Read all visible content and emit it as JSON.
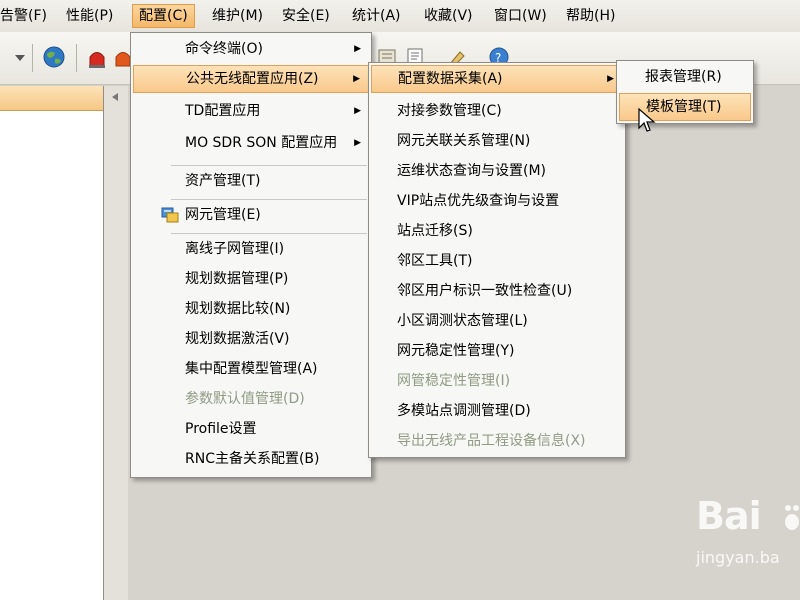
{
  "menubar": [
    {
      "label": "告警(F)"
    },
    {
      "label": "性能(P)"
    },
    {
      "label": "配置(C)"
    },
    {
      "label": "维护(M)"
    },
    {
      "label": "安全(E)"
    },
    {
      "label": "统计(A)"
    },
    {
      "label": "收藏(V)"
    },
    {
      "label": "窗口(W)"
    },
    {
      "label": "帮助(H)"
    }
  ],
  "config_menu": {
    "items": [
      {
        "label": "命令终端(O)"
      },
      {
        "label": "公共无线配置应用(Z)"
      },
      {
        "label": "TD配置应用"
      },
      {
        "label": "MO SDR SON 配置应用"
      },
      {
        "label": "资产管理(T)"
      },
      {
        "label": "网元管理(E)"
      },
      {
        "label": "离线子网管理(I)"
      },
      {
        "label": "规划数据管理(P)"
      },
      {
        "label": "规划数据比较(N)"
      },
      {
        "label": "规划数据激活(V)"
      },
      {
        "label": "集中配置模型管理(A)"
      },
      {
        "label": "参数默认值管理(D)"
      },
      {
        "label": "Profile设置"
      },
      {
        "label": "RNC主备关系配置(B)"
      }
    ]
  },
  "public_wireless_menu": {
    "items": [
      {
        "label": "配置数据采集(A)"
      },
      {
        "label": "对接参数管理(C)"
      },
      {
        "label": "网元关联关系管理(N)"
      },
      {
        "label": "运维状态查询与设置(M)"
      },
      {
        "label": "VIP站点优先级查询与设置"
      },
      {
        "label": "站点迁移(S)"
      },
      {
        "label": "邻区工具(T)"
      },
      {
        "label": "邻区用户标识一致性检查(U)"
      },
      {
        "label": "小区调测状态管理(L)"
      },
      {
        "label": "网元稳定性管理(Y)"
      },
      {
        "label": "网管稳定性管理(I)"
      },
      {
        "label": "多模站点调测管理(D)"
      },
      {
        "label": "导出无线产品工程设备信息(X)"
      }
    ]
  },
  "collect_menu": {
    "items": [
      {
        "label": "报表管理(R)"
      },
      {
        "label": "模板管理(T)"
      }
    ]
  },
  "watermark": {
    "brand": "Bai",
    "site": "jingyan.ba"
  },
  "colors": {
    "highlight": "#f9c98b",
    "disabled_text": "#8f9c83"
  }
}
